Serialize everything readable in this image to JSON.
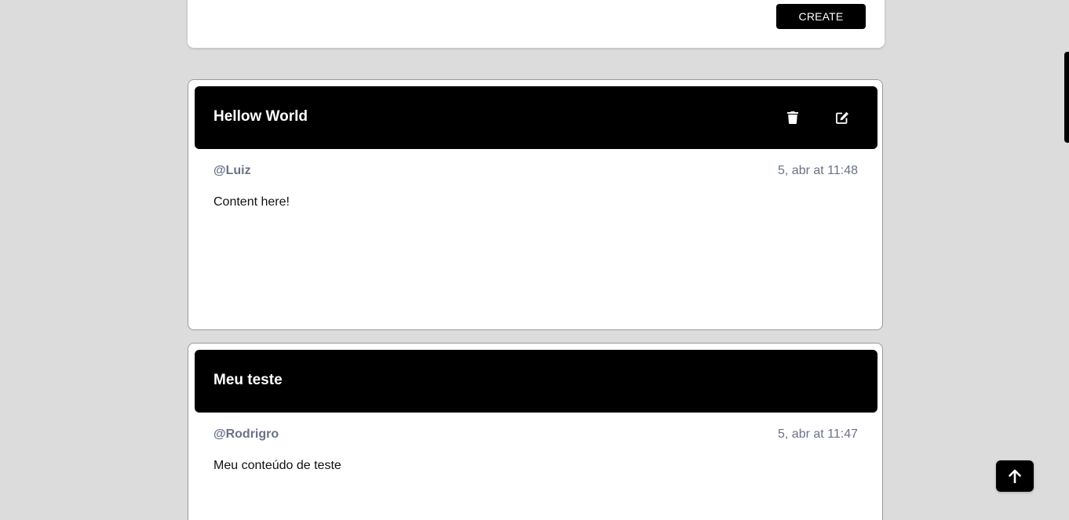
{
  "create": {
    "button_label": "CREATE"
  },
  "posts": [
    {
      "title": "Hellow World",
      "author": "@Luiz",
      "date": "5, abr at 11:48",
      "content": "Content here!",
      "actions": [
        "trash-icon",
        "edit-icon"
      ]
    },
    {
      "title": "Meu teste",
      "author": "@Rodrigro",
      "date": "5, abr at 11:47",
      "content": "Meu conteúdo de teste",
      "actions": []
    }
  ],
  "scroll_top": {
    "icon": "arrow-up-icon"
  },
  "colors": {
    "background": "#dcdcdc",
    "header": "#000000",
    "meta_text": "#6b7188",
    "card": "#ffffff"
  }
}
